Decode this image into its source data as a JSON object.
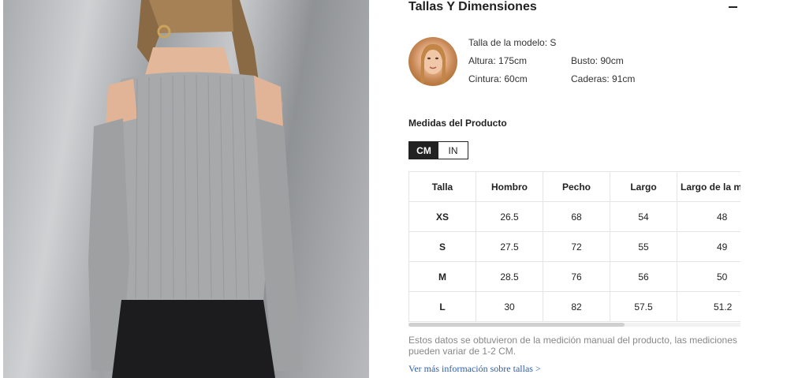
{
  "section": {
    "title": "Tallas Y Dimensiones",
    "collapse_icon": "minus-icon"
  },
  "model": {
    "avatar_icon": "model-avatar",
    "size": "Talla de la modelo: S",
    "height": "Altura: 175cm",
    "bust": "Busto: 90cm",
    "waist": "Cintura: 60cm",
    "hips": "Caderas: 91cm"
  },
  "measurements": {
    "title": "Medidas del Producto",
    "units": {
      "cm": "CM",
      "in": "IN",
      "selected": "CM"
    }
  },
  "table": {
    "headers": [
      "Talla",
      "Hombro",
      "Pecho",
      "Largo",
      "Largo de la manga"
    ],
    "rows": [
      [
        "XS",
        "26.5",
        "68",
        "54",
        "48"
      ],
      [
        "S",
        "27.5",
        "72",
        "55",
        "49"
      ],
      [
        "M",
        "28.5",
        "76",
        "56",
        "50"
      ],
      [
        "L",
        "30",
        "82",
        "57.5",
        "51.2"
      ]
    ]
  },
  "disclaimer": "Estos datos se obtuvieron de la medición manual del producto, las mediciones pueden variar de 1-2 CM.",
  "more_link": "Ver más información sobre tallas >",
  "colors": {
    "dark": "#222222",
    "link": "#2e5ea8",
    "muted": "#888888",
    "border": "#e5e5e5"
  }
}
